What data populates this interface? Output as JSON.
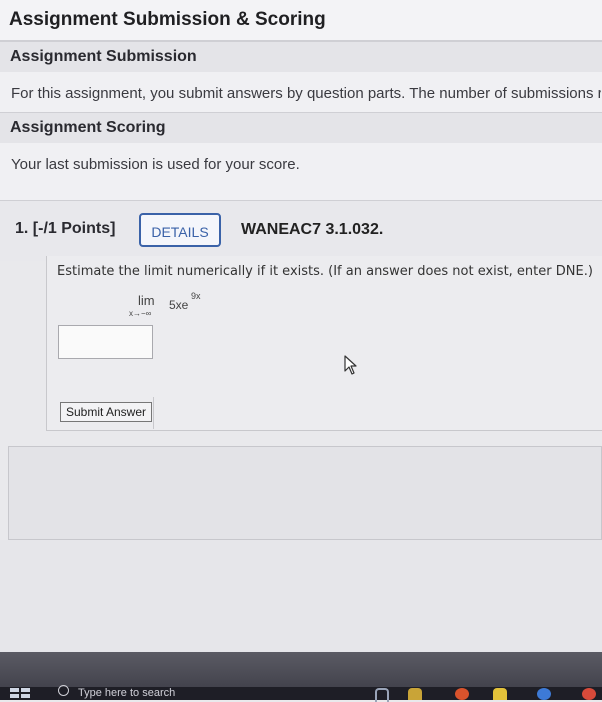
{
  "header": {
    "title": "Assignment Submission & Scoring"
  },
  "sections": {
    "submission": {
      "heading": "Assignment Submission",
      "text": "For this assignment, you submit answers by question parts. The number of submissions r"
    },
    "scoring": {
      "heading": "Assignment Scoring",
      "text": "Your last submission is used for your score."
    }
  },
  "question": {
    "number": "1.  [-/1 Points]",
    "details_label": "DETAILS",
    "code": "WANEAC7 3.1.032.",
    "prompt": "Estimate the limit numerically if it exists. (If an answer does not exist, enter DNE.)",
    "limit": {
      "word": "lim",
      "subscript": "x→−∞",
      "expression": "5xe",
      "exponent": "9x"
    },
    "answer_value": "",
    "submit_label": "Submit Answer"
  },
  "taskbar": {
    "search_placeholder": "Type here to search"
  },
  "colors": {
    "accent": "#3a62a8",
    "taskbar": "#3a3a44"
  }
}
